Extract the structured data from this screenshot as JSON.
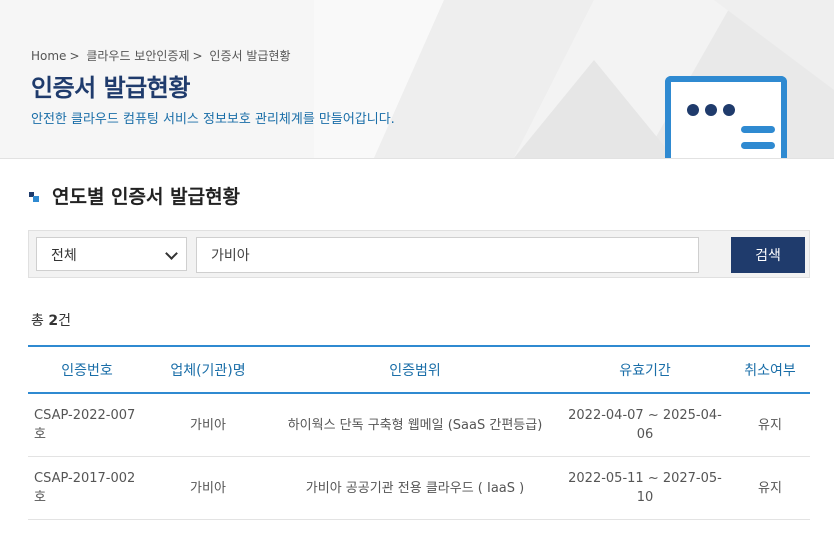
{
  "breadcrumb": [
    "Home",
    ">",
    "클라우드 보안인증제",
    ">",
    "인증서 발급현황"
  ],
  "header": {
    "title": "인증서 발급현황",
    "subtitle": "안전한 클라우드 컴퓨팅 서비스 정보보호 관리체계를 만들어갑니다."
  },
  "section": {
    "title": "연도별 인증서 발급현황"
  },
  "search": {
    "select_value": "전체",
    "input_value": "가비아",
    "button_label": "검색"
  },
  "result": {
    "prefix": "총",
    "count": "2",
    "suffix": "건"
  },
  "table": {
    "headers": [
      "인증번호",
      "업체(기관)명",
      "인증범위",
      "유효기간",
      "취소여부"
    ],
    "rows": [
      [
        "CSAP-2022-007호",
        "가비아",
        "하이웍스 단독 구축형 웹메일 (SaaS 간편등급)",
        "2022-04-07 ~ 2025-04-06",
        "유지"
      ],
      [
        "CSAP-2017-002호",
        "가비아",
        "가비아 공공기관 전용 클라우드 ( IaaS )",
        "2022-05-11 ~ 2027-05-10",
        "유지"
      ]
    ]
  },
  "colors": {
    "navy": "#1f3b6c",
    "blue": "#2f8ad1",
    "link": "#1a6ea8"
  }
}
